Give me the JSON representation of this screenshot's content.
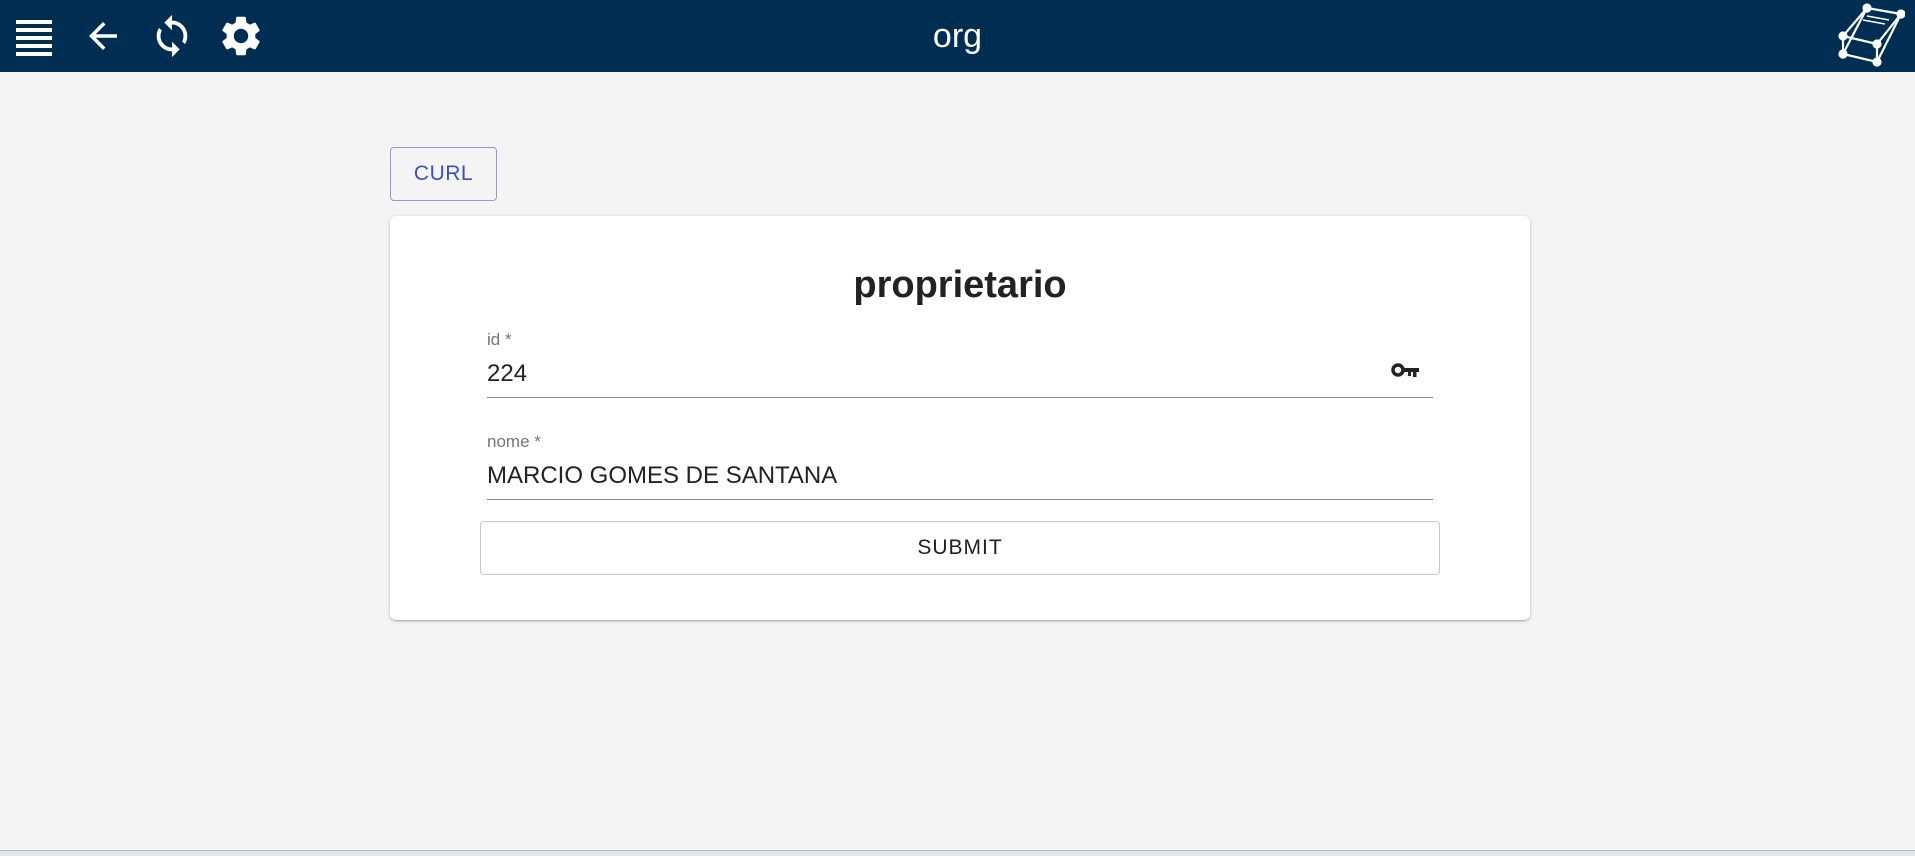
{
  "header": {
    "title": "org",
    "icons": [
      "menu-icon",
      "back-arrow-icon",
      "refresh-icon",
      "settings-gear-icon"
    ],
    "background_color": "#002e52"
  },
  "toolbar": {
    "curl_label": "CURL"
  },
  "form": {
    "title": "proprietario",
    "fields": [
      {
        "label": "id *",
        "value": "224",
        "icon": "key-icon"
      },
      {
        "label": "nome *",
        "value": "MARCIO GOMES DE SANTANA"
      }
    ],
    "submit_label": "SUBMIT"
  },
  "colors": {
    "accent": "#3f51b5",
    "page_background": "#f4f4f4"
  }
}
